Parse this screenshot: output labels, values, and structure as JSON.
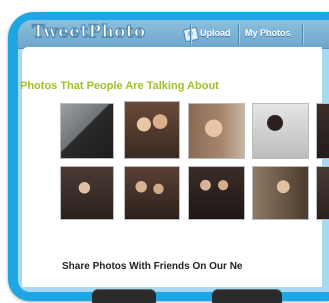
{
  "app": {
    "logo_text": "TweetPhoto",
    "nav": [
      {
        "label": "Upload"
      },
      {
        "label": "My Photos"
      }
    ]
  },
  "sections": {
    "talking_heading": "Photos That People Are Talking About",
    "share_heading": "Share Photos With Friends On Our Ne"
  },
  "colors": {
    "bezel": "#1ea5e3",
    "screen_bg": "#a9d8f2",
    "heading_green": "#9fbf2a"
  },
  "thumbnails": [
    {
      "tone": "#2a2a2a"
    },
    {
      "tone": "#6a4a3a"
    },
    {
      "tone": "#8a6a55"
    },
    {
      "tone": "#d8d8d8"
    },
    {
      "tone": "#3a2e2a"
    },
    {
      "tone": "#4a3a33"
    },
    {
      "tone": "#5a4036"
    },
    {
      "tone": "#3b2c28"
    },
    {
      "tone": "#6e5a48"
    },
    {
      "tone": "#4a3b34"
    }
  ]
}
